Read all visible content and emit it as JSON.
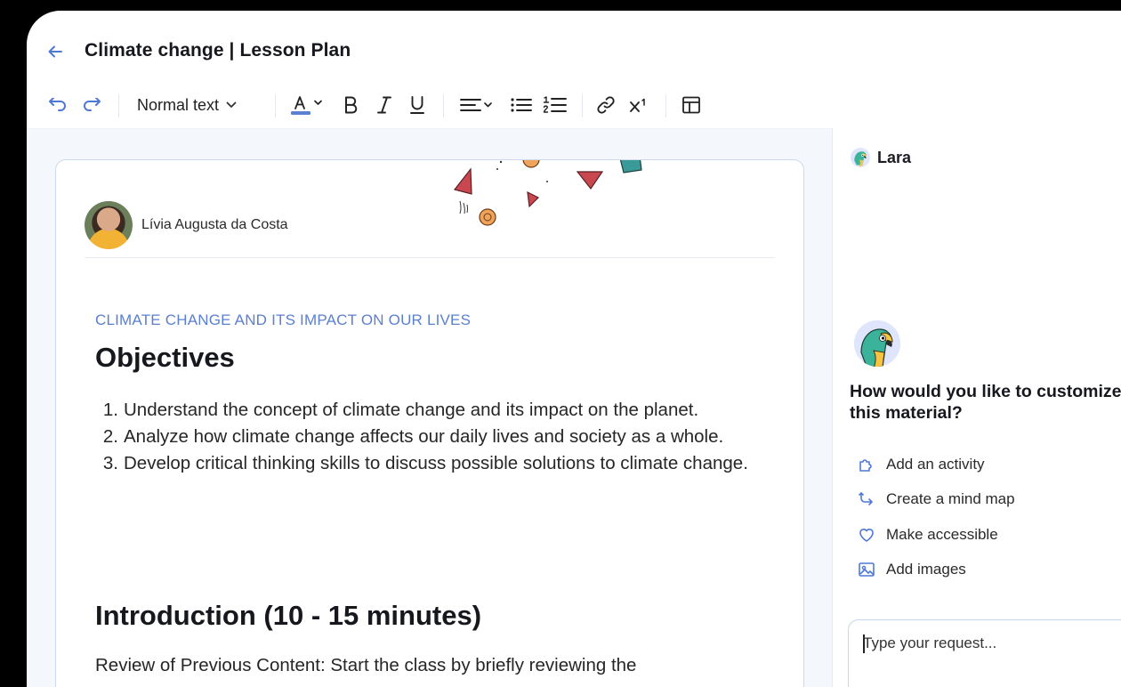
{
  "header": {
    "title": "Climate change | Lesson Plan"
  },
  "toolbar": {
    "text_style": "Normal text",
    "text_color": "#5b7fd1",
    "tools": [
      "undo-icon",
      "redo-icon",
      "text-color-icon",
      "bold-icon",
      "italic-icon",
      "underline-icon",
      "align-icon",
      "bullet-list-icon",
      "numbered-list-icon",
      "link-icon",
      "superscript-icon",
      "layout-icon"
    ]
  },
  "document": {
    "author": "Lívia Augusta da Costa",
    "subtitle": "CLIMATE CHANGE AND ITS IMPACT ON OUR LIVES",
    "objectives_heading": "Objectives",
    "objectives": [
      {
        "num": "1.",
        "text": "Understand the concept of climate change and its impact on the planet."
      },
      {
        "num": "2.",
        "text": "Analyze how climate change affects our daily lives and society as a whole."
      },
      {
        "num": "3.",
        "text": "Develop critical thinking skills to discuss possible solutions to climate change."
      }
    ],
    "intro_heading": "Introduction (10 - 15 minutes)",
    "intro_text": "Review of Previous Content: Start the class by briefly reviewing the"
  },
  "assistant": {
    "name": "Lara",
    "question": "How would you like to customize this material?",
    "actions": [
      {
        "label": "Add an activity",
        "icon": "puzzle-icon"
      },
      {
        "label": "Create a mind map",
        "icon": "mind-map-icon"
      },
      {
        "label": "Make accessible",
        "icon": "heart-icon"
      },
      {
        "label": "Add images",
        "icon": "image-icon"
      }
    ],
    "input_placeholder": "Type your request..."
  },
  "colors": {
    "accent": "#5b7fd1",
    "border": "#cdd9ea",
    "workspace_bg": "#f4f7fb"
  }
}
